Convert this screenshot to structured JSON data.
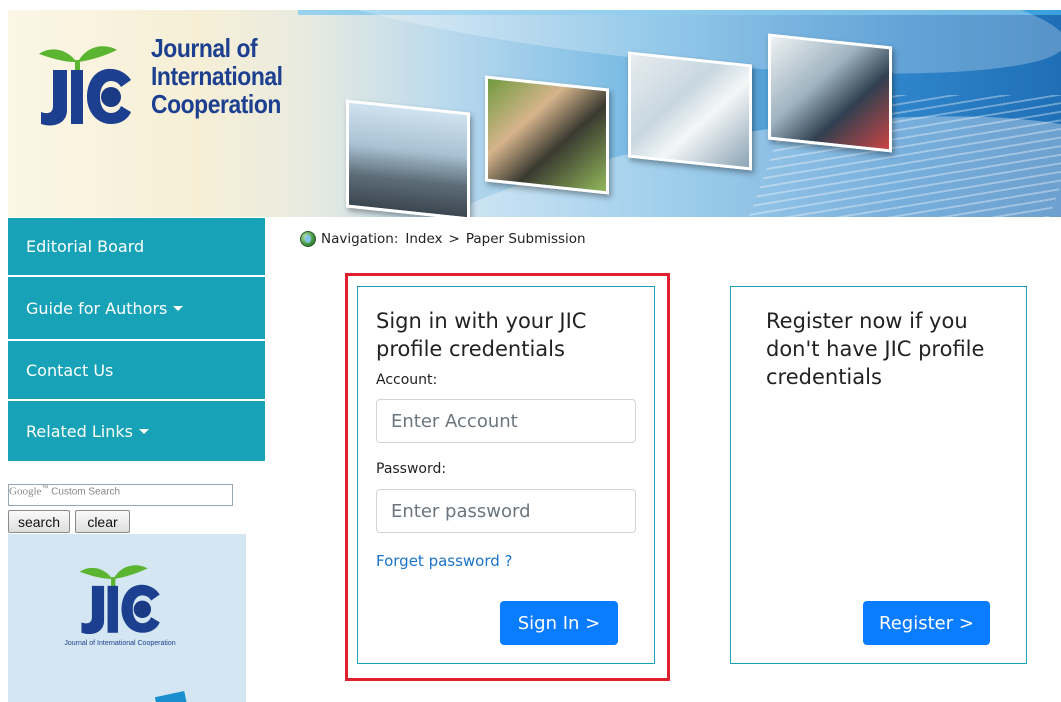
{
  "banner": {
    "title_lines": [
      "Journal of",
      "International",
      "Cooperation"
    ],
    "logo_text": "JIC"
  },
  "sidebar": {
    "items": [
      {
        "label": "Editorial Board",
        "has_caret": false
      },
      {
        "label": "Guide for Authors",
        "has_caret": true
      },
      {
        "label": "Contact Us",
        "has_caret": false
      },
      {
        "label": "Related Links",
        "has_caret": true
      }
    ],
    "accent_color": "#17a2b8"
  },
  "search": {
    "placeholder_brand": "Google",
    "placeholder_suffix": "Custom Search",
    "search_label": "search",
    "clear_label": "clear"
  },
  "side_logo": {
    "text": "JIC",
    "caption": "Journal of International Cooperation"
  },
  "breadcrumb": {
    "prefix": "Navigation:",
    "items": [
      "Index",
      "Paper Submission"
    ],
    "separator": ">",
    "icon": "globe-icon"
  },
  "signin": {
    "heading": "Sign in with your JIC profile credentials",
    "account_label": "Account:",
    "account_placeholder": "Enter Account",
    "password_label": "Password:",
    "password_placeholder": "Enter password",
    "forgot_label": "Forget password ?",
    "button_label": "Sign In >"
  },
  "register": {
    "heading": "Register now if you don't have JIC profile credentials",
    "button_label": "Register >"
  },
  "colors": {
    "primary_button": "#0a7cff",
    "highlight_border": "#e0202e",
    "link": "#1a73c9",
    "logo_navy": "#1d3f8f",
    "logo_sprout": "#5cb531"
  }
}
